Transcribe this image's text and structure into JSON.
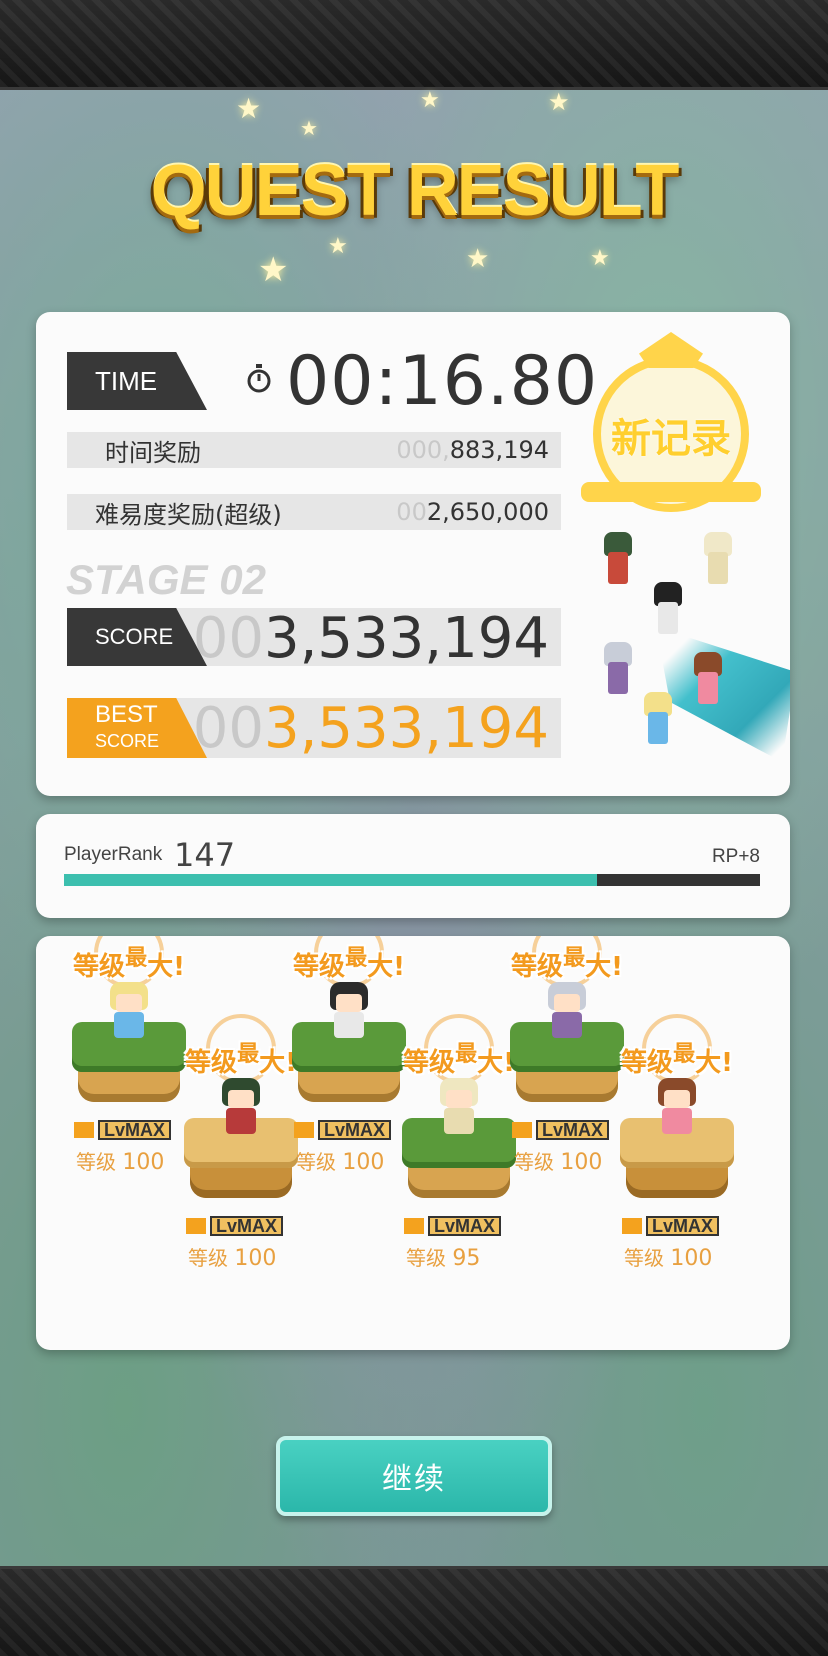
{
  "header": {
    "title": "QUEST RESULT"
  },
  "result": {
    "time_label": "TIME",
    "time_value": "00:16.80",
    "time_bonus_label": "时间奖励",
    "time_bonus_dim": "000,",
    "time_bonus_value": "883,194",
    "difficulty_bonus_label": "难易度奖励(超级)",
    "difficulty_bonus_dim": "00",
    "difficulty_bonus_value": "2,650,000",
    "stage": "STAGE 02",
    "score_label": "SCORE",
    "score_dim": "00",
    "score_value": "3,533,194",
    "best_label_line1": "BEST",
    "best_label_line2": "SCORE",
    "best_dim": "00",
    "best_value": "3,533,194",
    "new_record": "新记录"
  },
  "player": {
    "rank_label": "PlayerRank",
    "rank_value": "147",
    "rp_gain": "RP+8",
    "rank_progress": 0.766
  },
  "units": [
    {
      "max_label": "等级",
      "max_sup": "最",
      "max_end": "大!",
      "lvmax": "LvMAX",
      "level_label": "等级",
      "level": "100",
      "pedestal": "grass",
      "hair": "#f3e08a",
      "body": "#6ab7e8"
    },
    {
      "max_label": "等级",
      "max_sup": "最",
      "max_end": "大!",
      "lvmax": "LvMAX",
      "level_label": "等级",
      "level": "100",
      "pedestal": "sand",
      "hair": "#2f4a2f",
      "body": "#b73a3a"
    },
    {
      "max_label": "等级",
      "max_sup": "最",
      "max_end": "大!",
      "lvmax": "LvMAX",
      "level_label": "等级",
      "level": "100",
      "pedestal": "grass",
      "hair": "#2b2b2b",
      "body": "#e8e8e8"
    },
    {
      "max_label": "等级",
      "max_sup": "最",
      "max_end": "大!",
      "lvmax": "LvMAX",
      "level_label": "等级",
      "level": "95",
      "pedestal": "grass",
      "hair": "#efe7c0",
      "body": "#e8dcb0"
    },
    {
      "max_label": "等级",
      "max_sup": "最",
      "max_end": "大!",
      "lvmax": "LvMAX",
      "level_label": "等级",
      "level": "100",
      "pedestal": "grass",
      "hair": "#c8cdd8",
      "body": "#8a6aa8"
    },
    {
      "max_label": "等级",
      "max_sup": "最",
      "max_end": "大!",
      "lvmax": "LvMAX",
      "level_label": "等级",
      "level": "100",
      "pedestal": "sand",
      "hair": "#8a4a2a",
      "body": "#f08aa0"
    }
  ],
  "actions": {
    "continue_label": "继续"
  },
  "colors": {
    "accent_orange": "#f4a21e",
    "accent_teal": "#3cbfae",
    "title_gold": "#ffd23a"
  }
}
